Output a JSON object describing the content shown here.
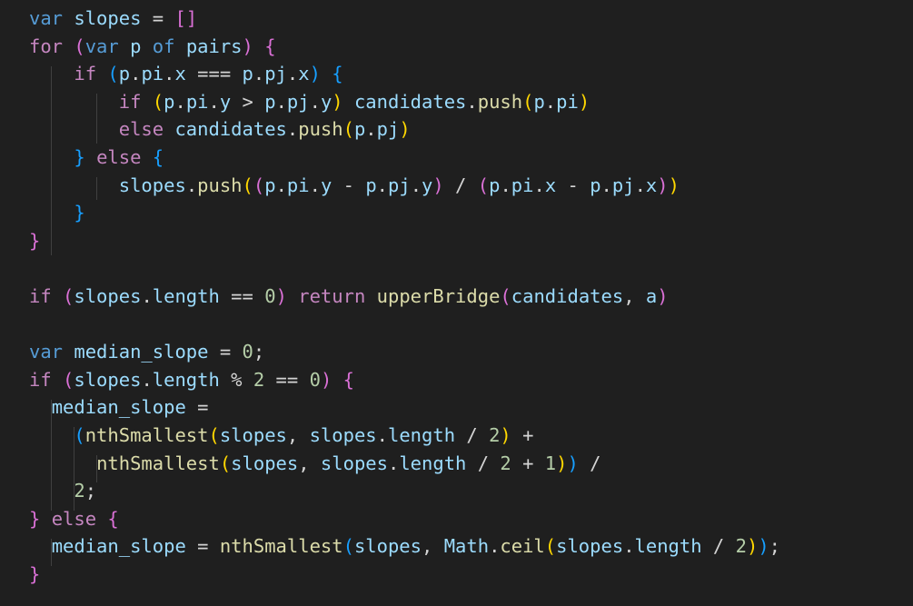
{
  "editor": {
    "lines": [
      [
        [
          "tok-kw2",
          "var"
        ],
        [
          "tok-plain",
          " "
        ],
        [
          "tok-id",
          "slopes"
        ],
        [
          "tok-plain",
          " = "
        ],
        [
          "tok-b2",
          "[]"
        ]
      ],
      [
        [
          "tok-kw",
          "for"
        ],
        [
          "tok-plain",
          " "
        ],
        [
          "tok-b2",
          "("
        ],
        [
          "tok-kw2",
          "var"
        ],
        [
          "tok-plain",
          " "
        ],
        [
          "tok-id",
          "p"
        ],
        [
          "tok-plain",
          " "
        ],
        [
          "tok-kw2",
          "of"
        ],
        [
          "tok-plain",
          " "
        ],
        [
          "tok-id",
          "pairs"
        ],
        [
          "tok-b2",
          ")"
        ],
        [
          "tok-plain",
          " "
        ],
        [
          "tok-b2",
          "{"
        ]
      ],
      [
        [
          "tok-plain",
          "    "
        ],
        [
          "tok-kw",
          "if"
        ],
        [
          "tok-plain",
          " "
        ],
        [
          "tok-b3",
          "("
        ],
        [
          "tok-id",
          "p"
        ],
        [
          "tok-plain",
          "."
        ],
        [
          "tok-id",
          "pi"
        ],
        [
          "tok-plain",
          "."
        ],
        [
          "tok-id",
          "x"
        ],
        [
          "tok-plain",
          " === "
        ],
        [
          "tok-id",
          "p"
        ],
        [
          "tok-plain",
          "."
        ],
        [
          "tok-id",
          "pj"
        ],
        [
          "tok-plain",
          "."
        ],
        [
          "tok-id",
          "x"
        ],
        [
          "tok-b3",
          ")"
        ],
        [
          "tok-plain",
          " "
        ],
        [
          "tok-b3",
          "{"
        ]
      ],
      [
        [
          "tok-plain",
          "        "
        ],
        [
          "tok-kw",
          "if"
        ],
        [
          "tok-plain",
          " "
        ],
        [
          "tok-b1",
          "("
        ],
        [
          "tok-id",
          "p"
        ],
        [
          "tok-plain",
          "."
        ],
        [
          "tok-id",
          "pi"
        ],
        [
          "tok-plain",
          "."
        ],
        [
          "tok-id",
          "y"
        ],
        [
          "tok-plain",
          " > "
        ],
        [
          "tok-id",
          "p"
        ],
        [
          "tok-plain",
          "."
        ],
        [
          "tok-id",
          "pj"
        ],
        [
          "tok-plain",
          "."
        ],
        [
          "tok-id",
          "y"
        ],
        [
          "tok-b1",
          ")"
        ],
        [
          "tok-plain",
          " "
        ],
        [
          "tok-id",
          "candidates"
        ],
        [
          "tok-plain",
          "."
        ],
        [
          "tok-fn",
          "push"
        ],
        [
          "tok-b1",
          "("
        ],
        [
          "tok-id",
          "p"
        ],
        [
          "tok-plain",
          "."
        ],
        [
          "tok-id",
          "pi"
        ],
        [
          "tok-b1",
          ")"
        ]
      ],
      [
        [
          "tok-plain",
          "        "
        ],
        [
          "tok-kw",
          "else"
        ],
        [
          "tok-plain",
          " "
        ],
        [
          "tok-id",
          "candidates"
        ],
        [
          "tok-plain",
          "."
        ],
        [
          "tok-fn",
          "push"
        ],
        [
          "tok-b1",
          "("
        ],
        [
          "tok-id",
          "p"
        ],
        [
          "tok-plain",
          "."
        ],
        [
          "tok-id",
          "pj"
        ],
        [
          "tok-b1",
          ")"
        ]
      ],
      [
        [
          "tok-plain",
          "    "
        ],
        [
          "tok-b3",
          "}"
        ],
        [
          "tok-plain",
          " "
        ],
        [
          "tok-kw",
          "else"
        ],
        [
          "tok-plain",
          " "
        ],
        [
          "tok-b3",
          "{"
        ]
      ],
      [
        [
          "tok-plain",
          "        "
        ],
        [
          "tok-id",
          "slopes"
        ],
        [
          "tok-plain",
          "."
        ],
        [
          "tok-fn",
          "push"
        ],
        [
          "tok-b1",
          "("
        ],
        [
          "tok-b2",
          "("
        ],
        [
          "tok-id",
          "p"
        ],
        [
          "tok-plain",
          "."
        ],
        [
          "tok-id",
          "pi"
        ],
        [
          "tok-plain",
          "."
        ],
        [
          "tok-id",
          "y"
        ],
        [
          "tok-plain",
          " - "
        ],
        [
          "tok-id",
          "p"
        ],
        [
          "tok-plain",
          "."
        ],
        [
          "tok-id",
          "pj"
        ],
        [
          "tok-plain",
          "."
        ],
        [
          "tok-id",
          "y"
        ],
        [
          "tok-b2",
          ")"
        ],
        [
          "tok-plain",
          " / "
        ],
        [
          "tok-b2",
          "("
        ],
        [
          "tok-id",
          "p"
        ],
        [
          "tok-plain",
          "."
        ],
        [
          "tok-id",
          "pi"
        ],
        [
          "tok-plain",
          "."
        ],
        [
          "tok-id",
          "x"
        ],
        [
          "tok-plain",
          " - "
        ],
        [
          "tok-id",
          "p"
        ],
        [
          "tok-plain",
          "."
        ],
        [
          "tok-id",
          "pj"
        ],
        [
          "tok-plain",
          "."
        ],
        [
          "tok-id",
          "x"
        ],
        [
          "tok-b2",
          ")"
        ],
        [
          "tok-b1",
          ")"
        ]
      ],
      [
        [
          "tok-plain",
          "    "
        ],
        [
          "tok-b3",
          "}"
        ]
      ],
      [
        [
          "tok-b2",
          "}"
        ]
      ],
      [],
      [
        [
          "tok-kw",
          "if"
        ],
        [
          "tok-plain",
          " "
        ],
        [
          "tok-b2",
          "("
        ],
        [
          "tok-id",
          "slopes"
        ],
        [
          "tok-plain",
          "."
        ],
        [
          "tok-id",
          "length"
        ],
        [
          "tok-plain",
          " == "
        ],
        [
          "tok-num",
          "0"
        ],
        [
          "tok-b2",
          ")"
        ],
        [
          "tok-plain",
          " "
        ],
        [
          "tok-kw",
          "return"
        ],
        [
          "tok-plain",
          " "
        ],
        [
          "tok-fn",
          "upperBridge"
        ],
        [
          "tok-b2",
          "("
        ],
        [
          "tok-id",
          "candidates"
        ],
        [
          "tok-plain",
          ", "
        ],
        [
          "tok-id",
          "a"
        ],
        [
          "tok-b2",
          ")"
        ]
      ],
      [],
      [
        [
          "tok-kw2",
          "var"
        ],
        [
          "tok-plain",
          " "
        ],
        [
          "tok-id",
          "median_slope"
        ],
        [
          "tok-plain",
          " = "
        ],
        [
          "tok-num",
          "0"
        ],
        [
          "tok-plain",
          ";"
        ]
      ],
      [
        [
          "tok-kw",
          "if"
        ],
        [
          "tok-plain",
          " "
        ],
        [
          "tok-b2",
          "("
        ],
        [
          "tok-id",
          "slopes"
        ],
        [
          "tok-plain",
          "."
        ],
        [
          "tok-id",
          "length"
        ],
        [
          "tok-plain",
          " % "
        ],
        [
          "tok-num",
          "2"
        ],
        [
          "tok-plain",
          " == "
        ],
        [
          "tok-num",
          "0"
        ],
        [
          "tok-b2",
          ")"
        ],
        [
          "tok-plain",
          " "
        ],
        [
          "tok-b2",
          "{"
        ]
      ],
      [
        [
          "tok-plain",
          "  "
        ],
        [
          "tok-id",
          "median_slope"
        ],
        [
          "tok-plain",
          " ="
        ]
      ],
      [
        [
          "tok-plain",
          "    "
        ],
        [
          "tok-b3",
          "("
        ],
        [
          "tok-fn",
          "nthSmallest"
        ],
        [
          "tok-b1",
          "("
        ],
        [
          "tok-id",
          "slopes"
        ],
        [
          "tok-plain",
          ", "
        ],
        [
          "tok-id",
          "slopes"
        ],
        [
          "tok-plain",
          "."
        ],
        [
          "tok-id",
          "length"
        ],
        [
          "tok-plain",
          " / "
        ],
        [
          "tok-num",
          "2"
        ],
        [
          "tok-b1",
          ")"
        ],
        [
          "tok-plain",
          " +"
        ]
      ],
      [
        [
          "tok-plain",
          "      "
        ],
        [
          "tok-fn",
          "nthSmallest"
        ],
        [
          "tok-b1",
          "("
        ],
        [
          "tok-id",
          "slopes"
        ],
        [
          "tok-plain",
          ", "
        ],
        [
          "tok-id",
          "slopes"
        ],
        [
          "tok-plain",
          "."
        ],
        [
          "tok-id",
          "length"
        ],
        [
          "tok-plain",
          " / "
        ],
        [
          "tok-num",
          "2"
        ],
        [
          "tok-plain",
          " + "
        ],
        [
          "tok-num",
          "1"
        ],
        [
          "tok-b1",
          ")"
        ],
        [
          "tok-b3",
          ")"
        ],
        [
          "tok-plain",
          " /"
        ]
      ],
      [
        [
          "tok-plain",
          "    "
        ],
        [
          "tok-num",
          "2"
        ],
        [
          "tok-plain",
          ";"
        ]
      ],
      [
        [
          "tok-b2",
          "}"
        ],
        [
          "tok-plain",
          " "
        ],
        [
          "tok-kw",
          "else"
        ],
        [
          "tok-plain",
          " "
        ],
        [
          "tok-b2",
          "{"
        ]
      ],
      [
        [
          "tok-plain",
          "  "
        ],
        [
          "tok-id",
          "median_slope"
        ],
        [
          "tok-plain",
          " = "
        ],
        [
          "tok-fn",
          "nthSmallest"
        ],
        [
          "tok-b3",
          "("
        ],
        [
          "tok-id",
          "slopes"
        ],
        [
          "tok-plain",
          ", "
        ],
        [
          "tok-id",
          "Math"
        ],
        [
          "tok-plain",
          "."
        ],
        [
          "tok-fn",
          "ceil"
        ],
        [
          "tok-b1",
          "("
        ],
        [
          "tok-id",
          "slopes"
        ],
        [
          "tok-plain",
          "."
        ],
        [
          "tok-id",
          "length"
        ],
        [
          "tok-plain",
          " / "
        ],
        [
          "tok-num",
          "2"
        ],
        [
          "tok-b1",
          ")"
        ],
        [
          "tok-b3",
          ")"
        ],
        [
          "tok-plain",
          ";"
        ]
      ],
      [
        [
          "tok-b2",
          "}"
        ]
      ]
    ]
  }
}
